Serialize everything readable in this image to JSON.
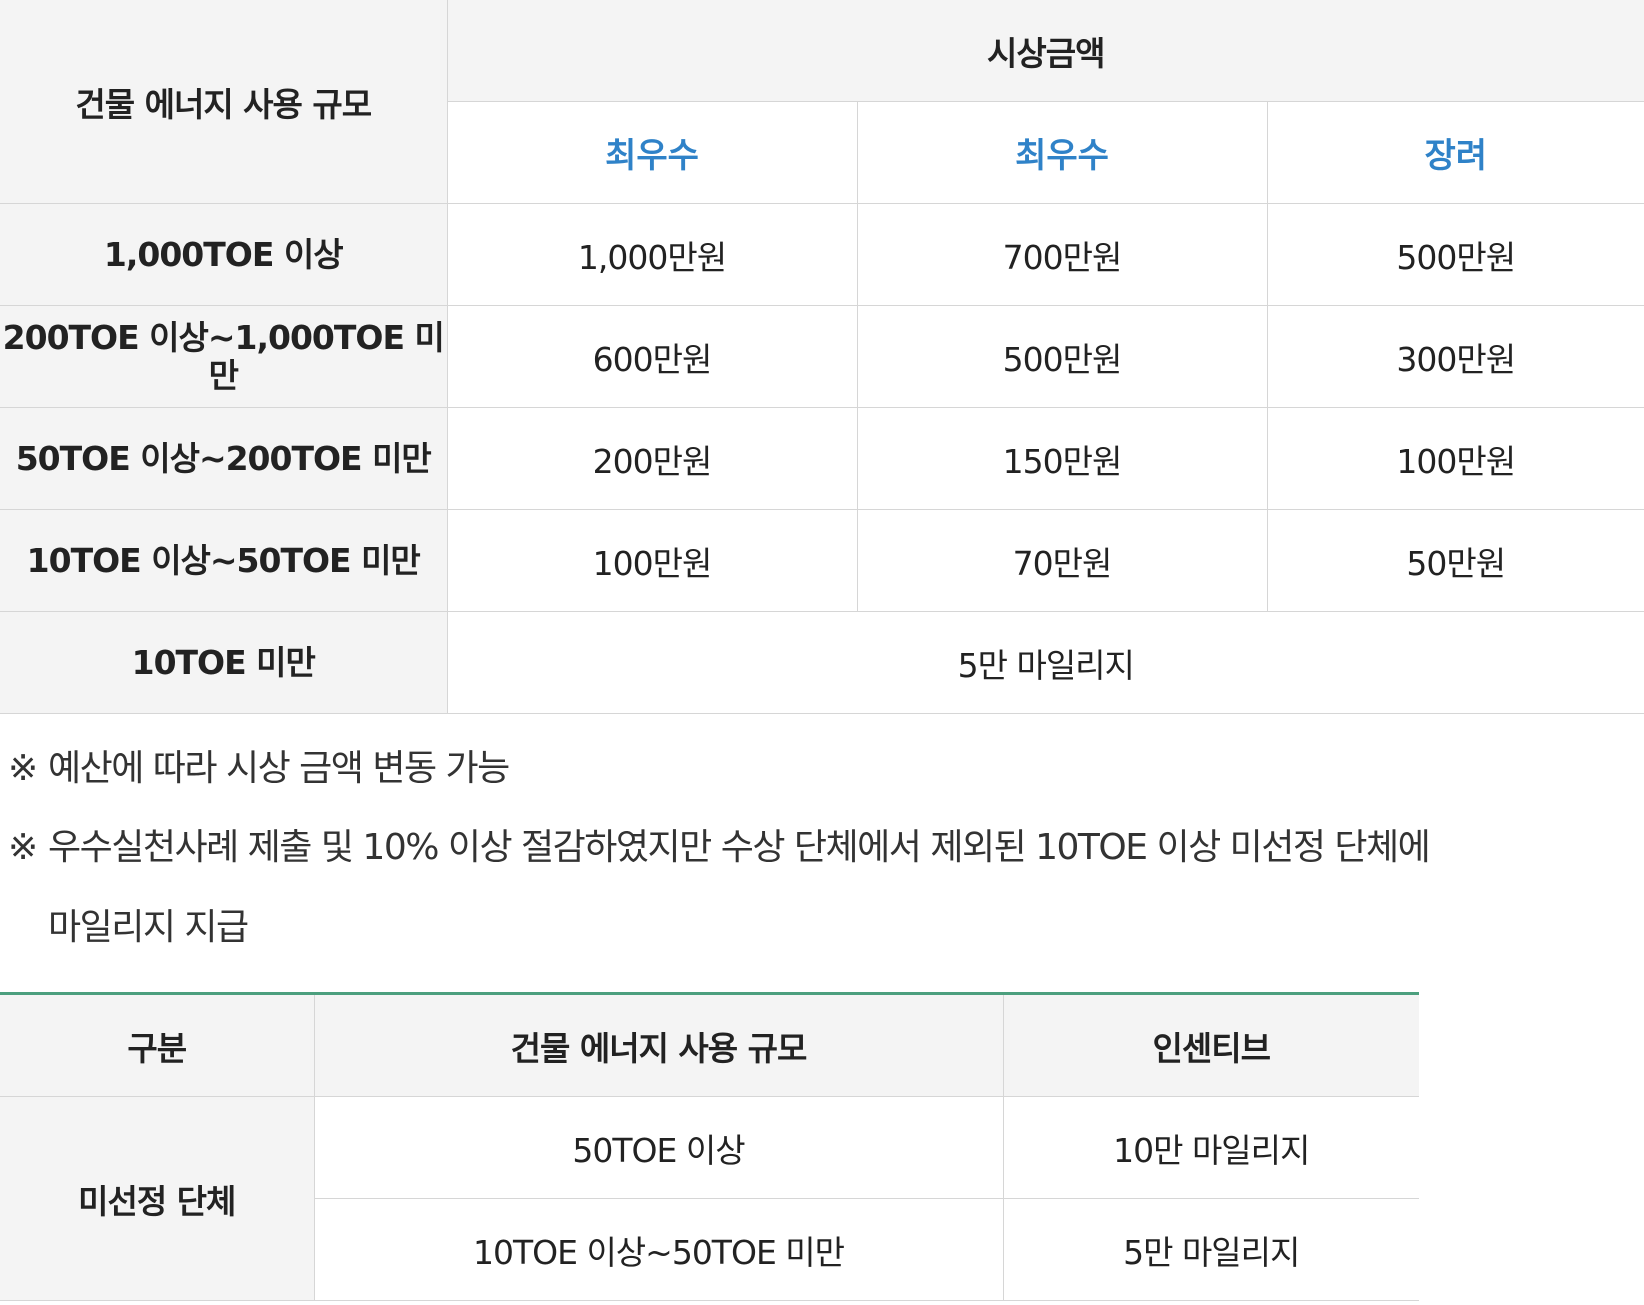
{
  "prize_table": {
    "header_scale": "건물 에너지 사용 규모",
    "header_amount": "시상금액",
    "grades": [
      "최우수",
      "최우수",
      "장려"
    ],
    "rows": [
      {
        "scale": "1,000TOE 이상",
        "values": [
          "1,000만원",
          "700만원",
          "500만원"
        ]
      },
      {
        "scale": "200TOE 이상~1,000TOE 미만",
        "values": [
          "600만원",
          "500만원",
          "300만원"
        ]
      },
      {
        "scale": "50TOE 이상~200TOE 미만",
        "values": [
          "200만원",
          "150만원",
          "100만원"
        ]
      },
      {
        "scale": "10TOE 이상~50TOE 미만",
        "values": [
          "100만원",
          "70만원",
          "50만원"
        ]
      }
    ],
    "last_row": {
      "scale": "10TOE 미만",
      "value": "5만 마일리지"
    }
  },
  "notes": {
    "symbol": "※",
    "note1": "예산에 따라 시상 금액 변동 가능",
    "note2_line1": "우수실천사례 제출 및 10% 이상 절감하였지만 수상 단체에서 제외된 10TOE 이상 미선정 단체에",
    "note2_line2": "마일리지 지급"
  },
  "incentive_table": {
    "headers": [
      "구분",
      "건물 에너지 사용 규모",
      "인센티브"
    ],
    "category": "미선정 단체",
    "rows": [
      {
        "scale": "50TOE 이상",
        "incentive": "10만 마일리지"
      },
      {
        "scale": "10TOE 이상~50TOE 미만",
        "incentive": "5만 마일리지"
      }
    ]
  },
  "colors": {
    "grade_text": "#2f82c8",
    "header_bg": "#f4f4f4",
    "border": "#d6d6d6",
    "accent_line": "#4c9f7e"
  }
}
